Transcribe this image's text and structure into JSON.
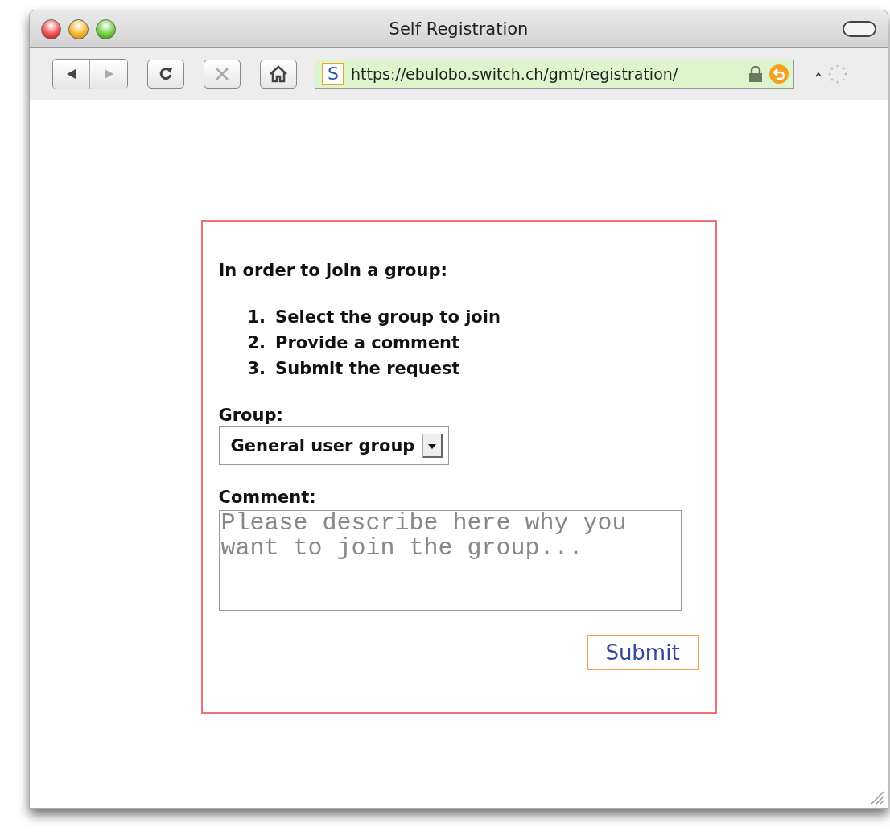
{
  "window": {
    "title": "Self Registration"
  },
  "toolbar": {
    "buttons": [
      {
        "kind": "back",
        "disabled": false
      },
      {
        "kind": "forward",
        "disabled": true
      },
      {
        "kind": "reload",
        "disabled": false
      },
      {
        "kind": "stop",
        "disabled": true
      },
      {
        "kind": "home",
        "disabled": false
      }
    ],
    "address": {
      "favicon": "S",
      "url": "https://ebulobo.switch.ch/gmt/registration/",
      "secure": true
    }
  },
  "form": {
    "heading": "In order to join a group:",
    "steps": [
      {
        "number": "1.",
        "text": "Select the group to join"
      },
      {
        "number": "2.",
        "text": "Provide a comment"
      },
      {
        "number": "3.",
        "text": "Submit the request"
      }
    ],
    "group": {
      "label": "Group:",
      "value": "General user group"
    },
    "comment": {
      "label": "Comment:",
      "placeholder": "Please describe here why you want to join the group..."
    },
    "submit": "Submit"
  }
}
